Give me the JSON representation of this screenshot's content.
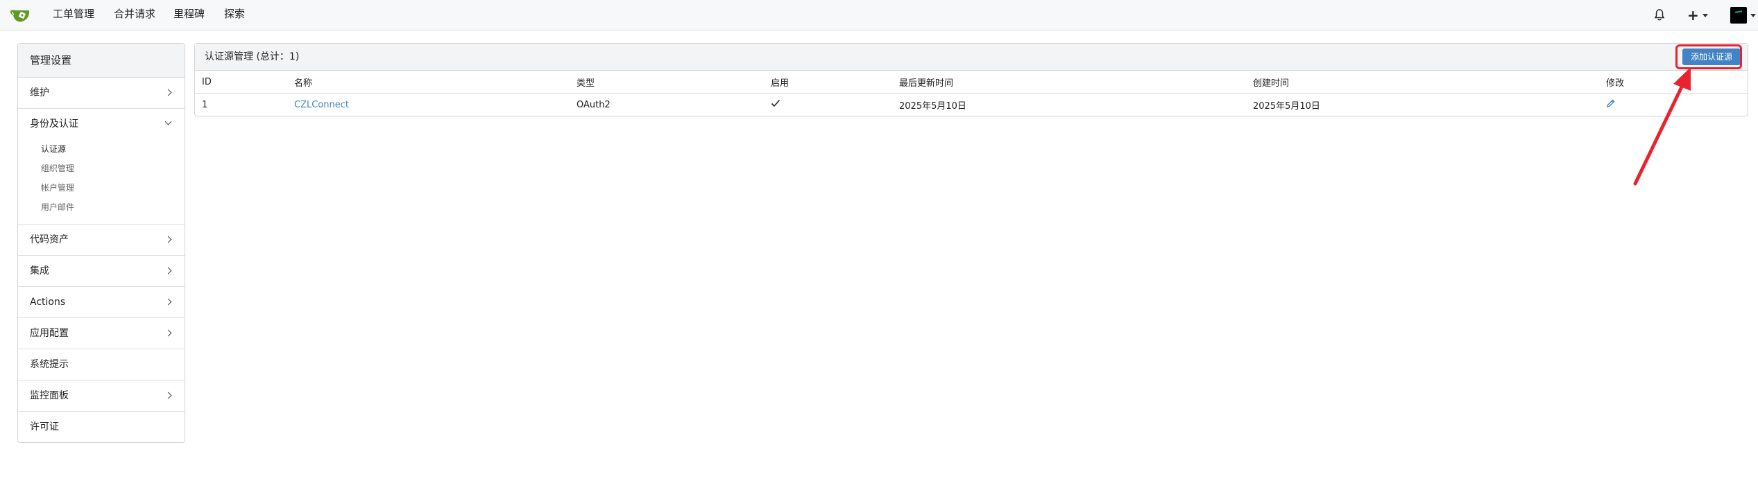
{
  "nav": {
    "items": [
      "工单管理",
      "合并请求",
      "里程碑",
      "探索"
    ]
  },
  "sidebar": {
    "title": "管理设置",
    "items": [
      {
        "label": "维护"
      },
      {
        "label": "身份及认证",
        "subitems": [
          "认证源",
          "组织管理",
          "帐户管理",
          "用户邮件"
        ]
      },
      {
        "label": "代码资产"
      },
      {
        "label": "集成"
      },
      {
        "label": "Actions"
      },
      {
        "label": "应用配置"
      },
      {
        "label": "系统提示"
      },
      {
        "label": "监控面板"
      },
      {
        "label": "许可证"
      }
    ]
  },
  "panel": {
    "title": "认证源管理 (总计：1)",
    "add_button": "添加认证源",
    "columns": [
      "ID",
      "名称",
      "类型",
      "启用",
      "最后更新时间",
      "创建时间",
      "修改"
    ],
    "rows": [
      {
        "id": "1",
        "name": "CZLConnect",
        "type": "OAuth2",
        "enabled": true,
        "updated": "2025年5月10日",
        "created": "2025年5月10日"
      }
    ]
  },
  "colors": {
    "accent": "#4183c4",
    "annotation": "#e8232f",
    "logo": "#609926"
  }
}
